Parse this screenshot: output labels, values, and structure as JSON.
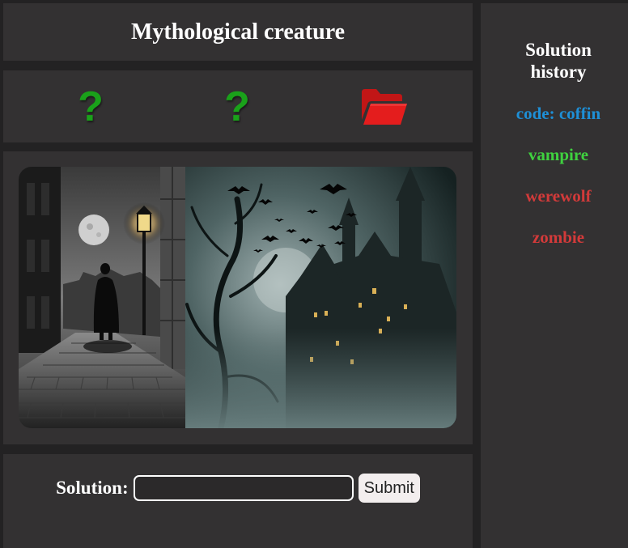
{
  "header": {
    "title": "Mythological creature"
  },
  "clues": [
    {
      "icon": "question-mark-icon",
      "text": "?",
      "color": "#1aa11a"
    },
    {
      "icon": "question-mark-icon",
      "text": "?",
      "color": "#1aa11a"
    },
    {
      "icon": "open-folder-icon",
      "color": "#e01b1b"
    }
  ],
  "solution": {
    "label": "Solution:",
    "input_value": "",
    "submit_label": "Submit"
  },
  "history": {
    "title_line1": "Solution",
    "title_line2": "history",
    "items": [
      {
        "text": "code: coffin",
        "color": "#1e8fd6"
      },
      {
        "text": "vampire",
        "color": "#3fd13f"
      },
      {
        "text": "werewolf",
        "color": "#d33a3a"
      },
      {
        "text": "zombie",
        "color": "#d33a3a"
      }
    ]
  }
}
